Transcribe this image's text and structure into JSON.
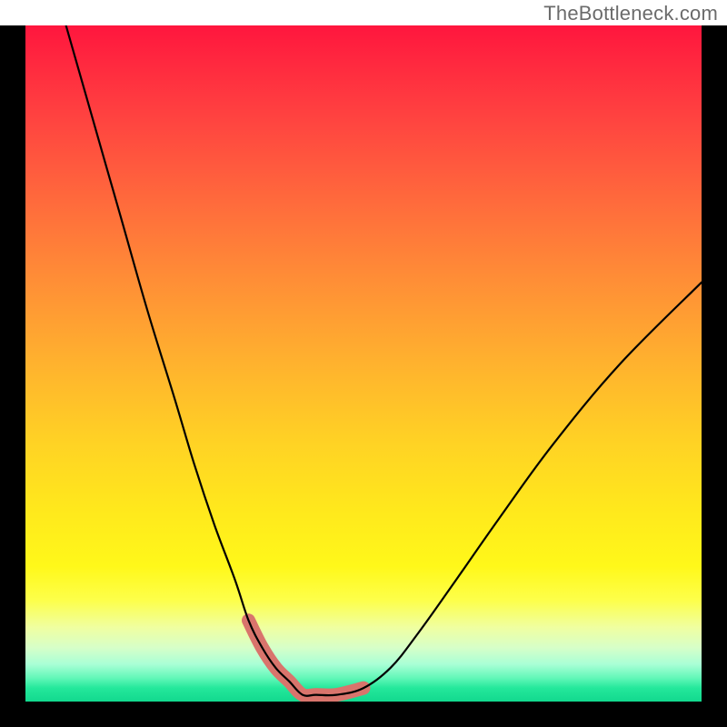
{
  "watermark": {
    "text": "TheBottleneck.com"
  },
  "chart_data": {
    "type": "line",
    "title": "",
    "xlabel": "",
    "ylabel": "",
    "xlim": [
      0,
      100
    ],
    "ylim": [
      0,
      100
    ],
    "background_gradient": {
      "top_color": "#ff163e",
      "mid_color": "#ffe91c",
      "bottom_color": "#12d98e",
      "orientation": "vertical"
    },
    "series": [
      {
        "name": "bottleneck-curve",
        "color": "#000000",
        "x": [
          6,
          10,
          14,
          18,
          22,
          25,
          28,
          31,
          33,
          35,
          37,
          39,
          41,
          43,
          46,
          50,
          54,
          58,
          63,
          70,
          78,
          88,
          100
        ],
        "y": [
          100,
          86,
          72,
          58,
          45,
          35,
          26,
          18,
          12,
          8,
          5,
          3,
          1,
          1,
          1,
          2,
          5,
          10,
          17,
          27,
          38,
          50,
          62
        ]
      },
      {
        "name": "optimal-zone",
        "color": "#d9746c",
        "x": [
          33,
          35,
          37,
          39,
          41,
          43,
          46,
          50
        ],
        "y": [
          12,
          8,
          5,
          3,
          1,
          1,
          1,
          2
        ]
      }
    ],
    "annotations": []
  }
}
